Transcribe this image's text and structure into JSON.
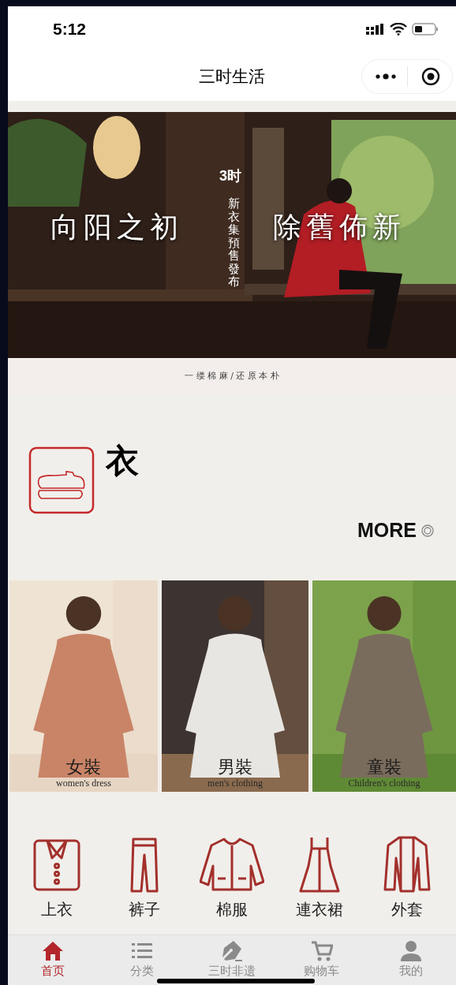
{
  "status_bar": {
    "time": "5:12"
  },
  "nav_bar": {
    "title": "三时生活"
  },
  "banner": {
    "kind": "picture",
    "logo": "3时",
    "vertical_caption": "新衣集預售發布",
    "headline_left": "向阳之初",
    "headline_right": "除舊佈新",
    "tagline": "一 缕 棉 麻 / 还 原 本 朴"
  },
  "section": {
    "title": "衣",
    "more": "MORE"
  },
  "categories": [
    {
      "title": "女裝",
      "subtitle": "women's dress"
    },
    {
      "title": "男裝",
      "subtitle": "men's clothing"
    },
    {
      "title": "童裝",
      "subtitle": "Children's clothing"
    }
  ],
  "subcategories": [
    {
      "label": "上衣",
      "kind": "shirt"
    },
    {
      "label": "裤子",
      "kind": "pants"
    },
    {
      "label": "棉服",
      "kind": "jacket"
    },
    {
      "label": "連衣裙",
      "kind": "dress"
    },
    {
      "label": "外套",
      "kind": "coat"
    }
  ],
  "tabs": [
    {
      "label": "首页",
      "kind": "home",
      "selected": true
    },
    {
      "label": "分类",
      "kind": "list",
      "selected": false
    },
    {
      "label": "三时非遗",
      "kind": "pen",
      "selected": false
    },
    {
      "label": "购物车",
      "kind": "cart",
      "selected": false
    },
    {
      "label": "我的",
      "kind": "user",
      "selected": false
    }
  ]
}
